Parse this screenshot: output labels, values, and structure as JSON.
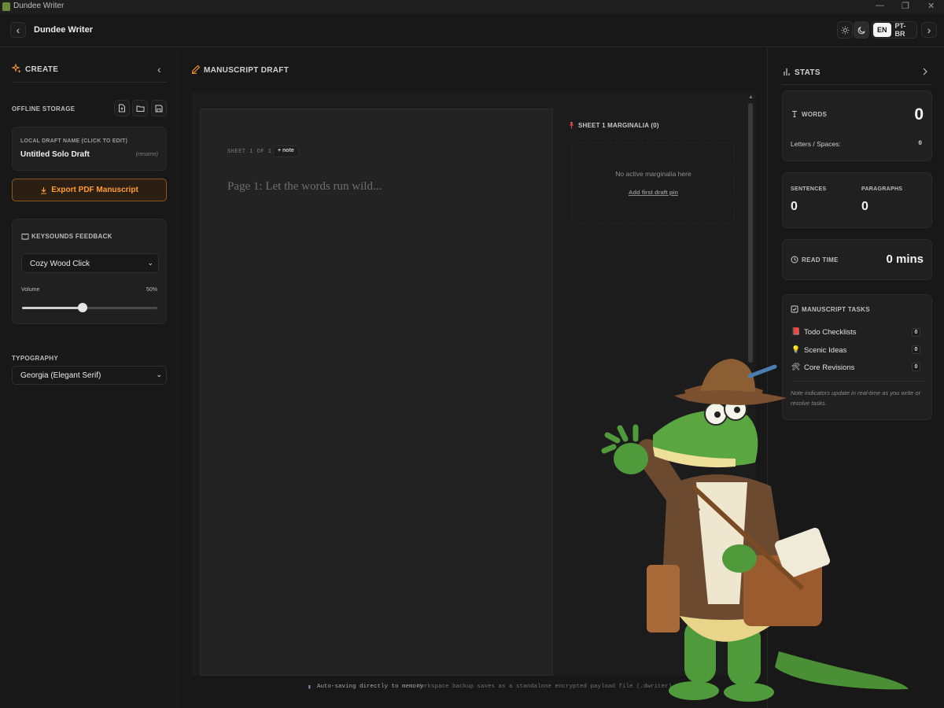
{
  "window": {
    "title": "Dundee Writer",
    "minimize": "—",
    "restore": "❐",
    "close": "✕"
  },
  "header": {
    "back_glyph": "‹",
    "app_name": "Dundee Writer",
    "lang_en": "EN",
    "lang_pt": "PT-BR",
    "next_glyph": "›"
  },
  "left": {
    "section_title": "CREATE",
    "collapse_glyph": "‹",
    "offline_storage": "OFFLINE STORAGE",
    "draft_name_label": "LOCAL DRAFT NAME (CLICK TO EDIT)",
    "draft_name": "Untitled Solo Draft",
    "rename_hint": "(rename)",
    "export_label": "Export PDF Manuscript",
    "keysounds_title": "KEYSOUNDS FEEDBACK",
    "keysound_selected": "Cozy Wood Click",
    "volume_label": "Volume",
    "volume_value": "50%",
    "volume_fraction": 0.45,
    "typography_title": "TYPOGRAPHY",
    "font_selected": "Georgia (Elegant Serif)"
  },
  "center": {
    "title": "MANUSCRIPT DRAFT",
    "sheet_label": "SHEET 1 OF 1",
    "note_button": "+ note",
    "placeholder": "Page 1: Let the words run wild...",
    "marginalia_title": "SHEET 1 MARGINALIA (0)",
    "marginalia_empty": "No active marginalia here",
    "add_pin": "Add first draft pin",
    "footer_icon": "▮",
    "footer_autosave": "Auto-saving directly to memory",
    "footer_backup": "Workspace backup saves as a standalone encrypted payload file (.dwriter)."
  },
  "right": {
    "title": "STATS",
    "words_label": "WORDS",
    "words_value": "0",
    "letters_label": "Letters / Spaces:",
    "letters_value": "0",
    "sentences_label": "SENTENCES",
    "sentences_value": "0",
    "paragraphs_label": "PARAGRAPHS",
    "paragraphs_value": "0",
    "readtime_label": "READ TIME",
    "readtime_value": "0 mins",
    "tasks_title": "MANUSCRIPT TASKS",
    "tasks": [
      {
        "label": "Todo Checklists",
        "count": "0",
        "icon": "📕"
      },
      {
        "label": "Scenic Ideas",
        "count": "0",
        "icon": "💡"
      },
      {
        "label": "Core Revisions",
        "count": "0",
        "icon": "🛠"
      }
    ],
    "tasks_note": "Note indicators update in real-time as you write or resolve tasks."
  },
  "colors": {
    "accent": "#ff9d2e",
    "background": "#181818",
    "card": "#202020",
    "mascot_green": "#4f9a3a",
    "mascot_jacket": "#6b4a2f"
  },
  "icons": [
    "sparkle-icon",
    "pencil-icon",
    "bar-chart-icon",
    "sun-icon",
    "moon-icon",
    "new-file-icon",
    "folder-open-icon",
    "save-icon",
    "download-icon",
    "book-icon",
    "pin-icon",
    "text-cursor-icon",
    "clock-icon",
    "checklist-icon"
  ]
}
